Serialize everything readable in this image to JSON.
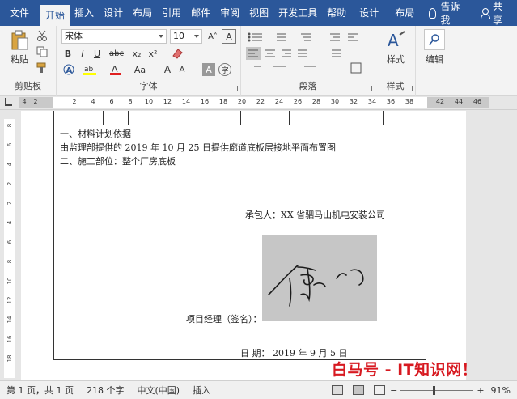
{
  "tabs": [
    {
      "label": "文件",
      "active": false
    },
    {
      "label": "开始",
      "active": true
    },
    {
      "label": "插入",
      "active": false
    },
    {
      "label": "设计",
      "active": false
    },
    {
      "label": "布局",
      "active": false
    },
    {
      "label": "引用",
      "active": false
    },
    {
      "label": "邮件",
      "active": false
    },
    {
      "label": "审阅",
      "active": false
    },
    {
      "label": "视图",
      "active": false
    },
    {
      "label": "开发工具",
      "active": false
    },
    {
      "label": "帮助",
      "active": false
    },
    {
      "label": "设计",
      "active": false
    },
    {
      "label": "布局",
      "active": false
    }
  ],
  "tell_me": "告诉我",
  "share": "共享",
  "ribbon": {
    "clipboard": {
      "label": "剪贴板",
      "paste": "粘贴"
    },
    "font": {
      "label": "字体",
      "font_name": "宋体",
      "font_size": "10",
      "bold": "B",
      "italic": "I",
      "underline": "U",
      "strike": "abc",
      "sub": "x₂",
      "sup": "x²",
      "grow": "A",
      "shrink": "A",
      "case": "Aa",
      "font_color": "A",
      "char_shade": "A",
      "enclose": "字"
    },
    "paragraph": {
      "label": "段落"
    },
    "styles": {
      "label": "样式",
      "button": "样式"
    },
    "editing": {
      "label": "",
      "button": "编辑"
    }
  },
  "ruler_ticks": [
    "4",
    "2",
    "2",
    "4",
    "6",
    "8",
    "10",
    "12",
    "14",
    "16",
    "18",
    "20",
    "22",
    "24",
    "26",
    "28",
    "30",
    "32",
    "34",
    "36",
    "38",
    "42",
    "44",
    "46"
  ],
  "vruler_ticks": [
    "8",
    "6",
    "4",
    "2",
    "2",
    "4",
    "6",
    "8",
    "10",
    "12",
    "14",
    "16",
    "18"
  ],
  "document": {
    "line1": "一、材料计划依据",
    "line2": "由监理部提供的 2019 年 10 月 25 日提供廊道底板层接地平面布置图",
    "line3": "二、施工部位：整个厂房底板",
    "contractor": "承包人：XX 省驷马山机电安装公司",
    "manager": "项目经理（签名）：",
    "date": "日    期：  2019  年   9  月  5   日"
  },
  "status": {
    "page": "第 1 页，共 1 页",
    "words": "218 个字",
    "language": "中文(中国)",
    "mode": "插入",
    "zoom": "91%"
  },
  "watermark": "白马号 - IT知识网！",
  "colors": {
    "accent": "#2b579a",
    "watermark": "#d71920"
  }
}
